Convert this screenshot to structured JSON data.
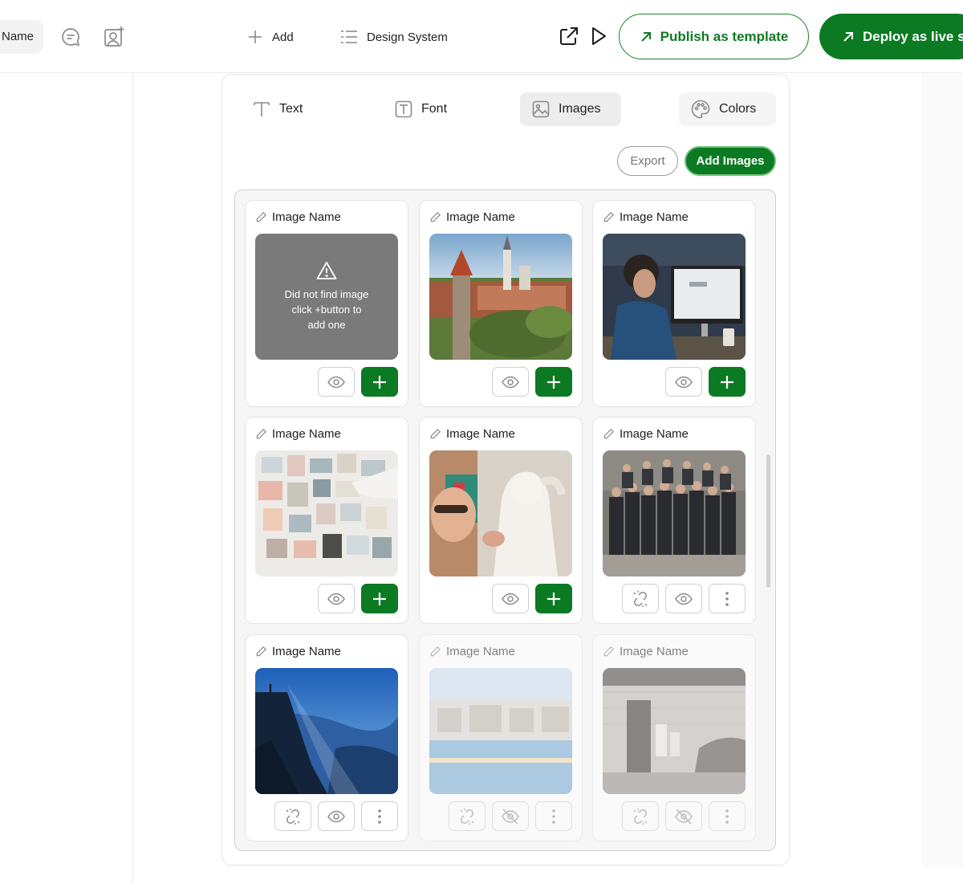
{
  "topbar": {
    "name_label": "Name",
    "add_label": "Add",
    "design_system_label": "Design System",
    "publish_label": "Publish as template",
    "deploy_label": "Deploy as live s"
  },
  "tabs": [
    {
      "label": "Text",
      "icon": "text-icon"
    },
    {
      "label": "Font",
      "icon": "font-icon"
    },
    {
      "label": "Images",
      "icon": "image-icon",
      "active": true
    },
    {
      "label": "Colors",
      "icon": "palette-icon"
    }
  ],
  "toolbar": {
    "export_label": "Export",
    "add_images_label": "Add Images"
  },
  "missing_image": {
    "line1": "Did not find image",
    "line2": "click +button to",
    "line3": "add one"
  },
  "cards": [
    {
      "name": "Image Name",
      "state": "missing"
    },
    {
      "name": "Image Name",
      "state": "city"
    },
    {
      "name": "Image Name",
      "state": "office"
    },
    {
      "name": "Image Name",
      "state": "moodboard"
    },
    {
      "name": "Image Name",
      "state": "sculpture"
    },
    {
      "name": "Image Name",
      "state": "group"
    },
    {
      "name": "Image Name",
      "state": "mountain"
    },
    {
      "name": "Image Name",
      "state": "harbor",
      "disabled": true
    },
    {
      "name": "Image Name",
      "state": "cafe",
      "disabled": true
    }
  ],
  "colors": {
    "brand_green": "#0b7a23",
    "missing_gray": "#7a7a7a"
  }
}
